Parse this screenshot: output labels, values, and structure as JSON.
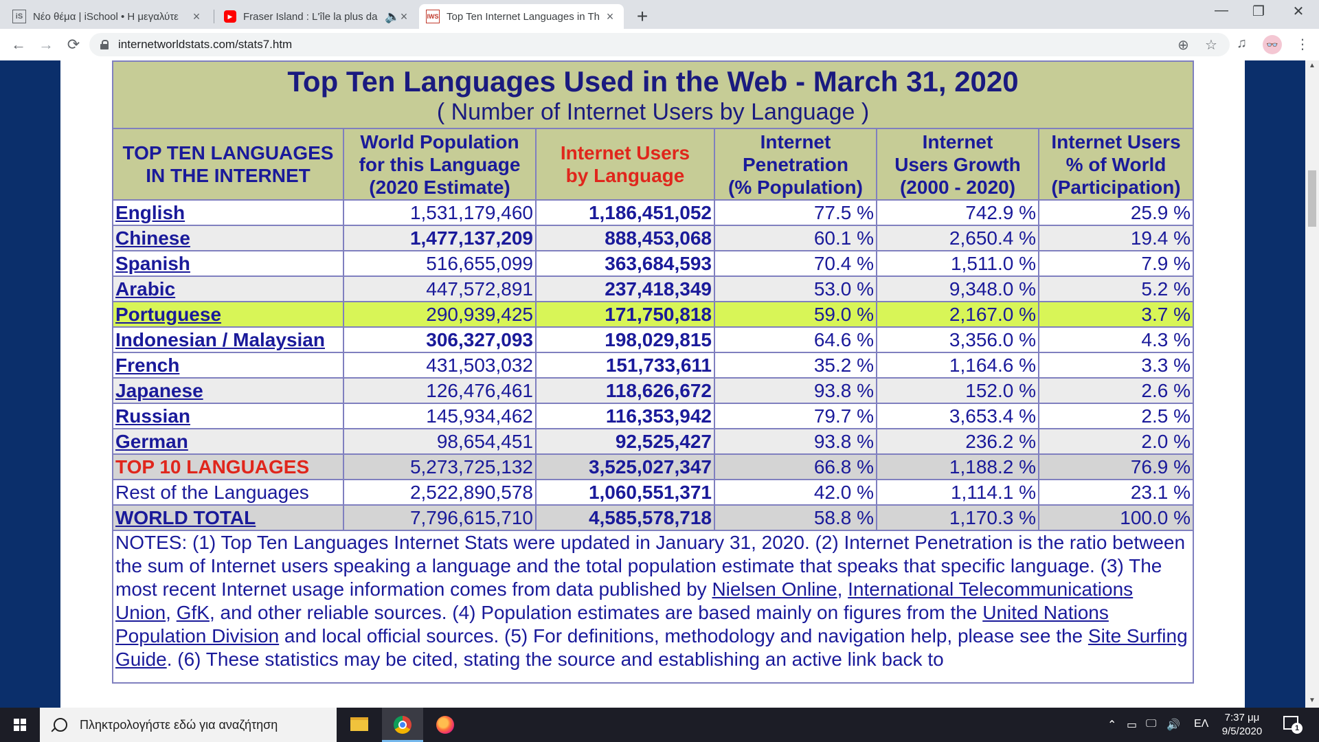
{
  "browser": {
    "tabs": [
      {
        "favicon": "iS",
        "title": "Νέο θέμα | iSchool • Η μεγαλύτε",
        "close": "×"
      },
      {
        "favicon": "▶",
        "title": "Fraser Island : L'île la plus da",
        "close": "×"
      },
      {
        "favicon": "IWS",
        "title": "Top Ten Internet Languages in Th",
        "close": "×"
      }
    ],
    "new_tab": "+",
    "window_controls": {
      "minimize": "—",
      "restore": "❐",
      "close": "✕"
    },
    "nav": {
      "back": "←",
      "forward": "→",
      "reload": "⟳"
    },
    "url": "internetworldstats.com/stats7.htm",
    "icons": {
      "zoom": "⊕",
      "bookmark": "☆",
      "media": "♫",
      "menu": "⋮",
      "profile": "👓"
    }
  },
  "table": {
    "title": "Top Ten Languages Used in the Web - March 31, 2020",
    "subtitle": "( Number of Internet Users by Language )",
    "headers": {
      "h1_line1": "TOP TEN LANGUAGES",
      "h1_line2": "IN THE INTERNET",
      "h2_line1": "World Population",
      "h2_line2": "for this Language",
      "h2_line3": "(2020 Estimate)",
      "h3_line1": "Internet Users",
      "h3_line2": "by Language",
      "h4_line1": "Internet",
      "h4_line2": "Penetration",
      "h4_line3": "(% Population)",
      "h5_line1": "Internet",
      "h5_line2": "Users Growth",
      "h5_line3": "(2000 - 2020)",
      "h6_line1": "Internet Users",
      "h6_line2": "% of World",
      "h6_line3": "(Participation)"
    },
    "rows": [
      {
        "language": "English",
        "population": "1,531,179,460",
        "users": "1,186,451,052",
        "penetration": "77.5 %",
        "growth": "742.9 %",
        "share": "25.9 %"
      },
      {
        "language": "Chinese",
        "population": "1,477,137,209",
        "users": "888,453,068",
        "penetration": "60.1 %",
        "growth": "2,650.4 %",
        "share": "19.4 %"
      },
      {
        "language": "Spanish",
        "population": "516,655,099",
        "users": "363,684,593",
        "penetration": "70.4 %",
        "growth": "1,511.0 %",
        "share": "7.9 %"
      },
      {
        "language": "Arabic",
        "population": "447,572,891",
        "users": "237,418,349",
        "penetration": "53.0 %",
        "growth": "9,348.0 %",
        "share": "5.2 %"
      },
      {
        "language": "Portuguese",
        "population": "290,939,425",
        "users": "171,750,818",
        "penetration": "59.0 %",
        "growth": "2,167.0 %",
        "share": "3.7 %"
      },
      {
        "language": "Indonesian / Malaysian",
        "population": "306,327,093",
        "users": "198,029,815",
        "penetration": "64.6 %",
        "growth": "3,356.0 %",
        "share": "4.3 %"
      },
      {
        "language": "French",
        "population": "431,503,032",
        "users": "151,733,611",
        "penetration": "35.2 %",
        "growth": "1,164.6 %",
        "share": "3.3 %"
      },
      {
        "language": "Japanese",
        "population": "126,476,461",
        "users": "118,626,672",
        "penetration": "93.8 %",
        "growth": "152.0 %",
        "share": "2.6 %"
      },
      {
        "language": "Russian",
        "population": "145,934,462",
        "users": "116,353,942",
        "penetration": "79.7 %",
        "growth": "3,653.4 %",
        "share": "2.5 %"
      },
      {
        "language": "German",
        "population": "98,654,451",
        "users": "92,525,427",
        "penetration": "93.8 %",
        "growth": "236.2 %",
        "share": "2.0 %"
      }
    ],
    "top10": {
      "language": "TOP 10 LANGUAGES",
      "population": "5,273,725,132",
      "users": "3,525,027,347",
      "penetration": "66.8 %",
      "growth": "1,188.2 %",
      "share": "76.9 %"
    },
    "rest": {
      "language": "Rest of the Languages",
      "population": "2,522,890,578",
      "users": "1,060,551,371",
      "penetration": "42.0 %",
      "growth": "1,114.1 %",
      "share": "23.1 %"
    },
    "world": {
      "language": "WORLD TOTAL",
      "population": "7,796,615,710",
      "users": "4,585,578,718",
      "penetration": "58.8 %",
      "growth": "1,170.3 %",
      "share": "100.0 %"
    },
    "notes": {
      "t1": "NOTES: (1) Top Ten Languages Internet Stats were updated in January 31, 2020. (2) Internet Penetration is the ratio between the sum of Internet users speaking a language and the total population estimate that speaks that specific language. (3) The most recent Internet usage information comes from data published by ",
      "l1": "Nielsen Online",
      "t2": ", ",
      "l2": "International Telecommunications Union",
      "t3": ", ",
      "l3": "GfK",
      "t4": ", and other reliable sources. (4) Population estimates are based mainly on figures from the ",
      "l4": "United Nations Population Division",
      "t5": " and local official sources. (5) For definitions, methodology and navigation help, please see the ",
      "l5": "Site Surfing Guide",
      "t6": ". (6) These statistics may be cited, stating the source and establishing an active link back to"
    }
  },
  "taskbar": {
    "search_placeholder": "Πληκτρολογήστε εδώ για αναζήτηση",
    "tray": {
      "chevron": "⌃",
      "battery": "▭",
      "network": "🖵",
      "volume": "🔊",
      "lang": "ΕΛ"
    },
    "time": "7:37 μμ",
    "date": "9/5/2020",
    "notif_count": "1"
  },
  "colors": {
    "header_bg": "#c6cc96",
    "title_text": "#1a1a7f",
    "highlight_row": "#d8f557",
    "red_text": "#e0261c",
    "page_bg": "#0b2f6b"
  }
}
